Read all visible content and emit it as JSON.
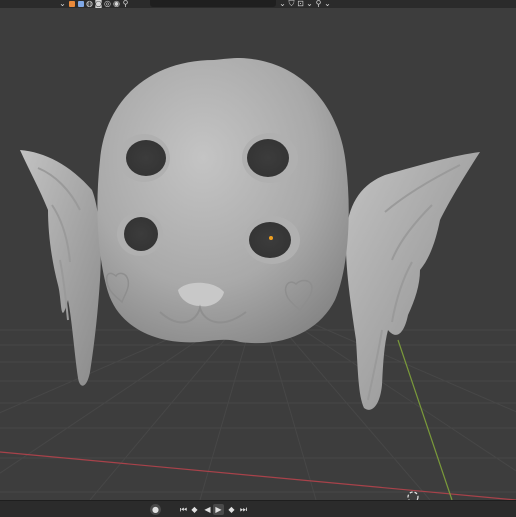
{
  "header": {
    "left_icons": [
      {
        "name": "dropdown-chevron-icon",
        "glyph": "⌄"
      },
      {
        "name": "material-preview-icon",
        "color": "#e9893a"
      },
      {
        "name": "selectability-icon",
        "color": "#7fa8e6"
      },
      {
        "name": "visibility-icon",
        "glyph": "◍"
      },
      {
        "name": "camera-icon",
        "glyph": "◙"
      },
      {
        "name": "render-icon",
        "glyph": "◎"
      },
      {
        "name": "sphere-icon",
        "glyph": "◉"
      },
      {
        "name": "search-icon",
        "glyph": "⚲"
      }
    ],
    "right_icons": [
      {
        "name": "dropdown-chevron-icon",
        "glyph": "⌄"
      },
      {
        "name": "filter-icon",
        "glyph": "⛉"
      },
      {
        "name": "overlay-icon",
        "glyph": "⊡"
      },
      {
        "name": "chevron-down-icon",
        "glyph": "⌄"
      },
      {
        "name": "pin-icon",
        "glyph": "⚲"
      },
      {
        "name": "chevron-down-icon",
        "glyph": "⌄"
      }
    ]
  },
  "timeline": {
    "controls": [
      {
        "name": "record-button",
        "glyph": "●"
      },
      {
        "name": "jump-start-button",
        "glyph": "⏮"
      },
      {
        "name": "prev-keyframe-button",
        "glyph": "◆"
      },
      {
        "name": "play-reverse-button",
        "glyph": "◀"
      },
      {
        "name": "play-button",
        "glyph": "▶"
      },
      {
        "name": "next-keyframe-button",
        "glyph": "◆"
      },
      {
        "name": "jump-end-button",
        "glyph": "⏭"
      }
    ]
  },
  "colors": {
    "background": "#3d3d3d",
    "grid": "#4a4a4a",
    "x_axis": "#a8424a",
    "y_axis": "#7a9a3a",
    "mesh": "#b5b5b5",
    "origin": "#f0a020"
  }
}
